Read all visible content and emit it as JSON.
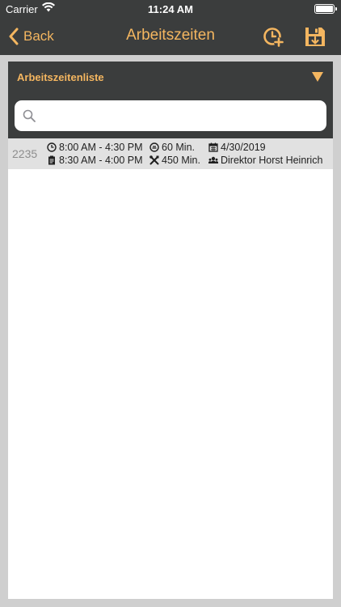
{
  "status_bar": {
    "carrier": "Carrier",
    "time": "11:24 AM"
  },
  "nav": {
    "back_label": "Back",
    "title": "Arbeitszeiten"
  },
  "panel": {
    "title": "Arbeitszeitenliste",
    "search": {
      "value": "",
      "placeholder": ""
    }
  },
  "rows": [
    {
      "id": "2235",
      "planned_time": "8:00 AM - 4:30 PM",
      "break": "60 Min.",
      "date": "4/30/2019",
      "actual_time": "8:30 AM - 4:00 PM",
      "work_minutes": "450 Min.",
      "person": "Direktor Horst Heinrich"
    }
  ],
  "colors": {
    "bar": "#3b3d3d",
    "accent": "#f4b660",
    "row_bg": "#e1e1e1"
  }
}
